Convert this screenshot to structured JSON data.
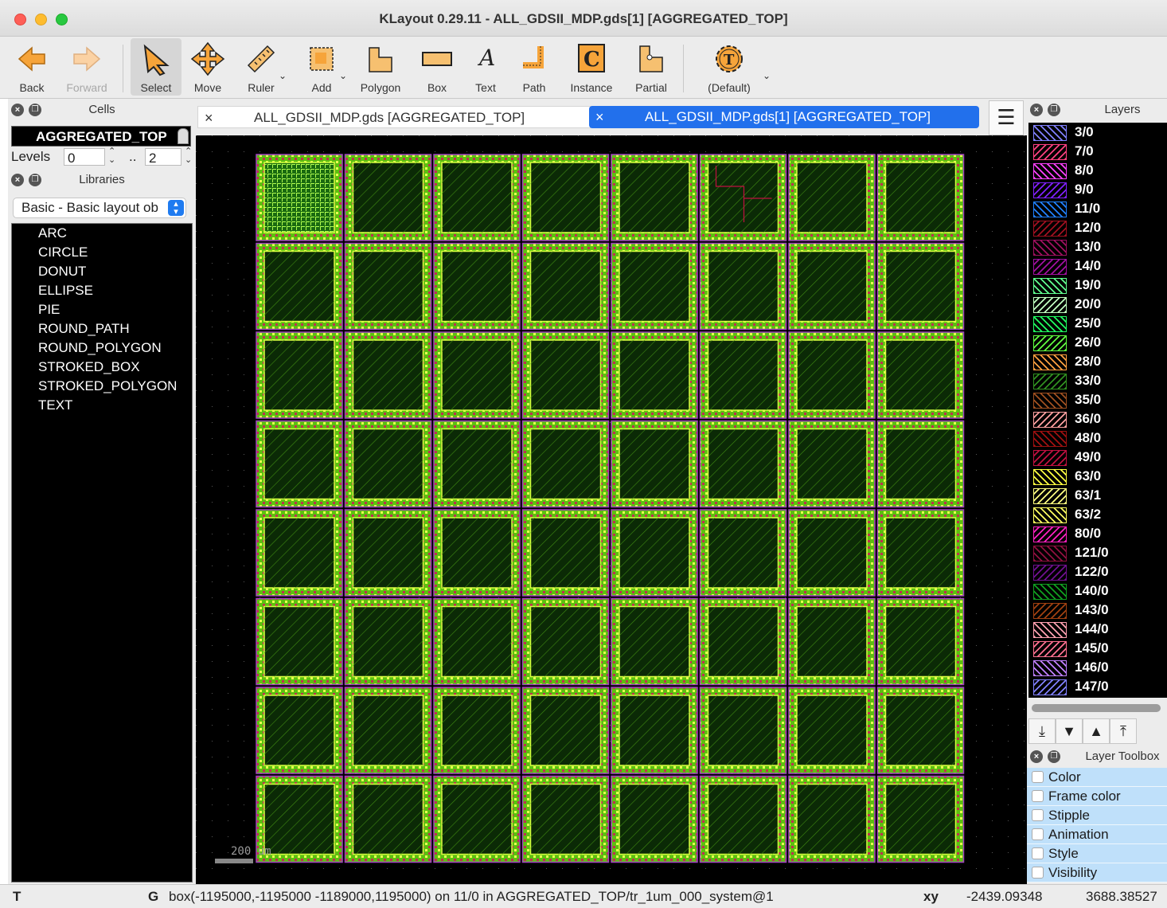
{
  "window": {
    "title": "KLayout 0.29.11 - ALL_GDSII_MDP.gds[1] [AGGREGATED_TOP]"
  },
  "toolbar": {
    "back": "Back",
    "forward": "Forward",
    "select": "Select",
    "move": "Move",
    "ruler": "Ruler",
    "add": "Add",
    "polygon": "Polygon",
    "box": "Box",
    "text": "Text",
    "path": "Path",
    "instance": "Instance",
    "partial": "Partial",
    "default": "(Default)"
  },
  "cells": {
    "header": "Cells",
    "current": "AGGREGATED_TOP",
    "levels_label": "Levels",
    "level_from": "0",
    "level_sep": "..",
    "level_to": "2"
  },
  "libraries": {
    "header": "Libraries",
    "selected": "Basic - Basic layout ob",
    "items": [
      "ARC",
      "CIRCLE",
      "DONUT",
      "ELLIPSE",
      "PIE",
      "ROUND_PATH",
      "ROUND_POLYGON",
      "STROKED_BOX",
      "STROKED_POLYGON",
      "TEXT"
    ]
  },
  "tabs": [
    {
      "close": "×",
      "label": "ALL_GDSII_MDP.gds [AGGREGATED_TOP]"
    },
    {
      "close": "×",
      "label": "ALL_GDSII_MDP.gds[1] [AGGREGATED_TOP]"
    }
  ],
  "canvas": {
    "scale_label": "200 um"
  },
  "layers": {
    "header": "Layers",
    "items": [
      {
        "name": "3/0",
        "color": "#8080ff"
      },
      {
        "name": "7/0",
        "color": "#ff4080"
      },
      {
        "name": "8/0",
        "color": "#ff40ff"
      },
      {
        "name": "9/0",
        "color": "#8020ff"
      },
      {
        "name": "11/0",
        "color": "#2080ff"
      },
      {
        "name": "12/0",
        "color": "#a01020"
      },
      {
        "name": "13/0",
        "color": "#a01060"
      },
      {
        "name": "14/0",
        "color": "#a010a0"
      },
      {
        "name": "19/0",
        "color": "#60ff90"
      },
      {
        "name": "20/0",
        "color": "#c0ffc0"
      },
      {
        "name": "25/0",
        "color": "#20ff60"
      },
      {
        "name": "26/0",
        "color": "#60ff40"
      },
      {
        "name": "28/0",
        "color": "#ffa040"
      },
      {
        "name": "33/0",
        "color": "#309020"
      },
      {
        "name": "35/0",
        "color": "#a05020"
      },
      {
        "name": "36/0",
        "color": "#ffa0a0"
      },
      {
        "name": "48/0",
        "color": "#a01010"
      },
      {
        "name": "49/0",
        "color": "#c01040"
      },
      {
        "name": "63/0",
        "color": "#ffff40"
      },
      {
        "name": "63/1",
        "color": "#ffff80"
      },
      {
        "name": "63/2",
        "color": "#ffff60"
      },
      {
        "name": "80/0",
        "color": "#ff20c0"
      },
      {
        "name": "121/0",
        "color": "#901040"
      },
      {
        "name": "122/0",
        "color": "#701090"
      },
      {
        "name": "140/0",
        "color": "#10a020"
      },
      {
        "name": "143/0",
        "color": "#a04010"
      },
      {
        "name": "144/0",
        "color": "#ffa0b0"
      },
      {
        "name": "145/0",
        "color": "#ff7090"
      },
      {
        "name": "146/0",
        "color": "#c080ff"
      },
      {
        "name": "147/0",
        "color": "#8080ff"
      }
    ]
  },
  "layer_toolbox": {
    "header": "Layer Toolbox",
    "items": [
      "Color",
      "Frame color",
      "Stipple",
      "Animation",
      "Style",
      "Visibility"
    ]
  },
  "status": {
    "mode": "T",
    "grid": "G",
    "message": "box(-1195000,-1195000 -1189000,1195000) on 11/0 in AGGREGATED_TOP/tr_1um_000_system@1",
    "coord_label": "xy",
    "x": "-2439.09348",
    "y": "3688.38527"
  }
}
